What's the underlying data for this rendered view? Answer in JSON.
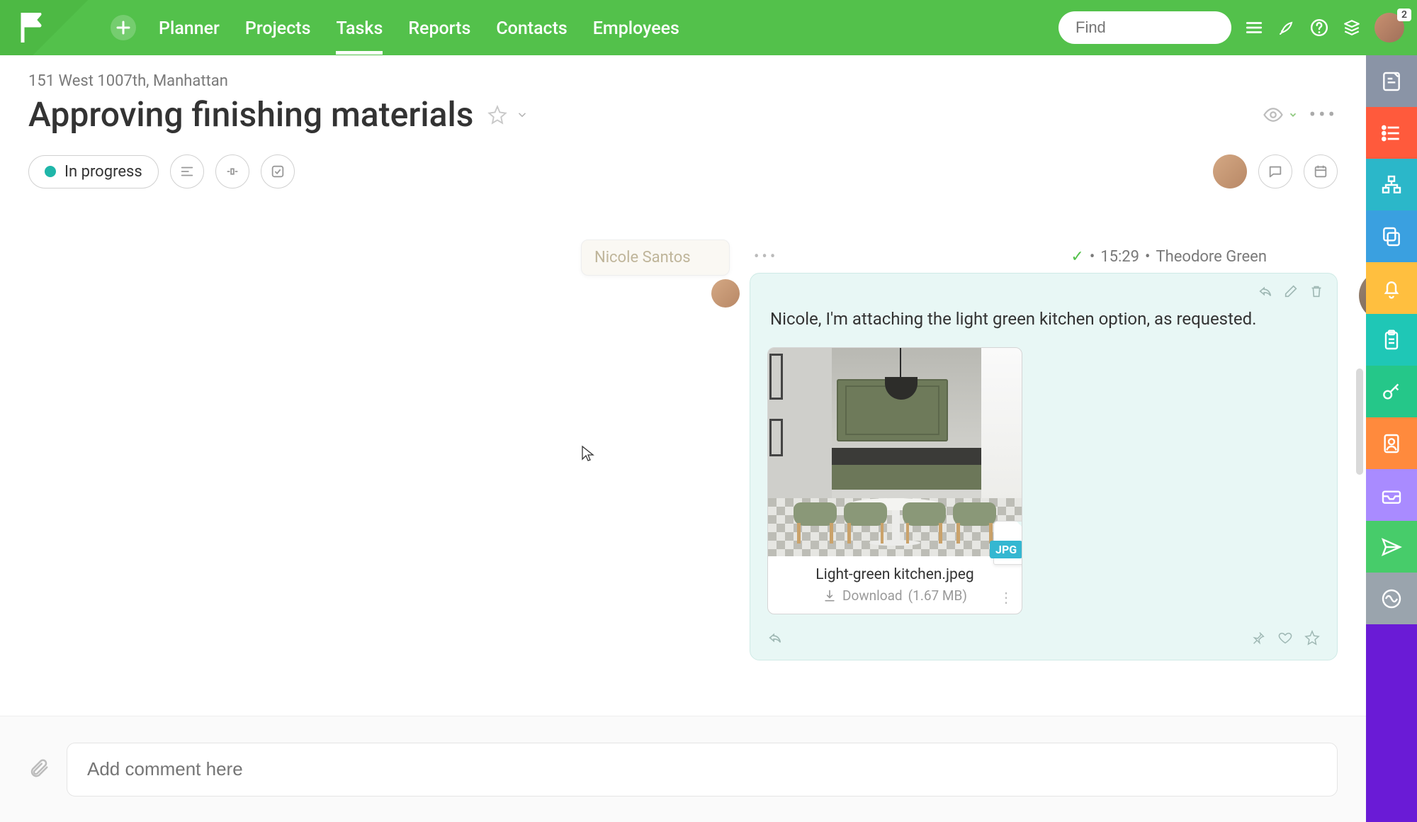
{
  "nav": {
    "items": [
      "Planner",
      "Projects",
      "Tasks",
      "Reports",
      "Contacts",
      "Employees"
    ],
    "active_index": 2,
    "search_placeholder": "Find",
    "badge": "2"
  },
  "sidebar_colors": [
    "#8a94a6",
    "#ff5a3c",
    "#2bb7c9",
    "#3aa0e0",
    "#ffbf3f",
    "#1fc7b6",
    "#25c789",
    "#ff8a3d",
    "#a98bff",
    "#47cc6a",
    "#9aa4ad"
  ],
  "page": {
    "breadcrumb": "151 West 1007th, Manhattan",
    "title": "Approving finishing materials",
    "status": "In progress"
  },
  "tooltip": {
    "name": "Nicole Santos"
  },
  "comment": {
    "time": "15:29",
    "author": "Theodore Green",
    "text": "Nicole, I'm attaching the light green kitchen option, as requested.",
    "attachment": {
      "filename": "Light-green kitchen.jpeg",
      "ext_label": "JPG",
      "download_label": "Download",
      "size": "(1.67 MB)"
    }
  },
  "compose": {
    "placeholder": "Add comment here"
  }
}
